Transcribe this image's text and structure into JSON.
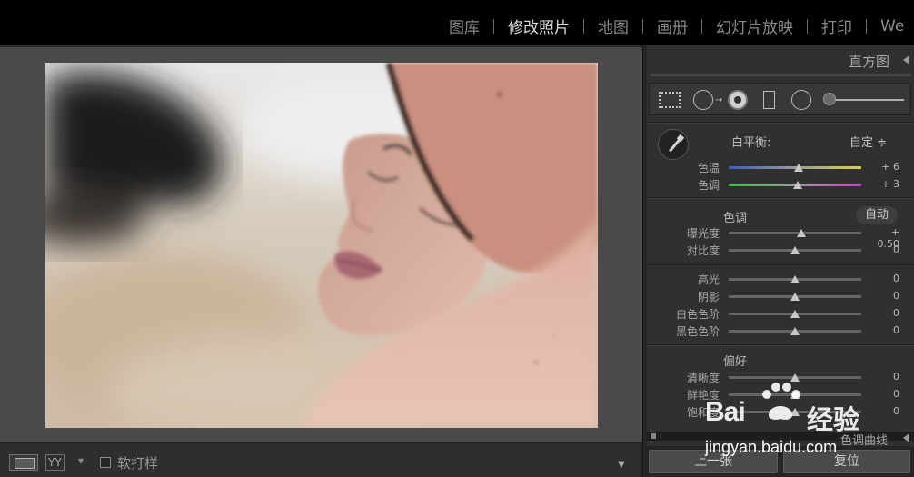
{
  "top_modules": [
    {
      "label": "图库",
      "active": false
    },
    {
      "label": "修改照片",
      "active": true
    },
    {
      "label": "地图",
      "active": false
    },
    {
      "label": "画册",
      "active": false
    },
    {
      "label": "幻灯片放映",
      "active": false
    },
    {
      "label": "打印",
      "active": false
    },
    {
      "label": "We",
      "active": false
    }
  ],
  "histogram": {
    "title": "直方图"
  },
  "tool_strip": {
    "icons": [
      "crop-icon",
      "spot-removal-icon",
      "red-eye-icon",
      "graduated-filter-icon",
      "radial-filter-icon",
      "adjustment-brush-slider"
    ]
  },
  "white_balance": {
    "label": "白平衡:",
    "value": "自定 ≑",
    "sliders": [
      {
        "label": "色温",
        "value": "+ 6",
        "pos": 0.53,
        "track": "temp"
      },
      {
        "label": "色调",
        "value": "+ 3",
        "pos": 0.52,
        "track": "tint"
      }
    ]
  },
  "tone": {
    "title": "色调",
    "auto_label": "自动",
    "sliders": [
      {
        "label": "曝光度",
        "value": "+ 0.50",
        "pos": 0.55
      },
      {
        "label": "对比度",
        "value": "0",
        "pos": 0.5
      },
      {
        "label": "高光",
        "value": "0",
        "pos": 0.5
      },
      {
        "label": "阴影",
        "value": "0",
        "pos": 0.5
      },
      {
        "label": "白色色阶",
        "value": "0",
        "pos": 0.5
      },
      {
        "label": "黑色色阶",
        "value": "0",
        "pos": 0.5
      }
    ]
  },
  "presence": {
    "title": "偏好",
    "sliders": [
      {
        "label": "清晰度",
        "value": "0",
        "pos": 0.5
      },
      {
        "label": "鲜艳度",
        "value": "0",
        "pos": 0.5
      },
      {
        "label": "饱和度",
        "value": "0",
        "pos": 0.5
      }
    ]
  },
  "tone_curve": {
    "title": "色调曲线"
  },
  "buttons": {
    "previous": "上一张",
    "reset": "复位"
  },
  "toolbar": {
    "yy_label": "YY",
    "soft_proof_label": "软打样"
  },
  "watermark": {
    "brand": "Bai",
    "brand_cn": "经验",
    "url": "jingyan.baidu.com"
  }
}
